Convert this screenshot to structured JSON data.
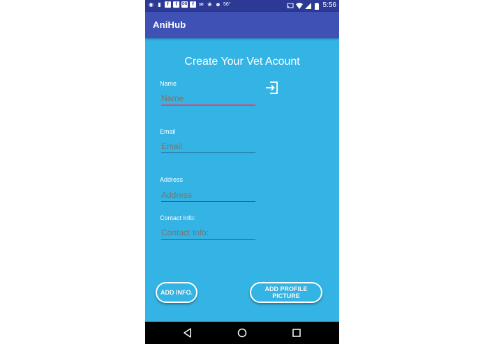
{
  "status_bar": {
    "time": "5:56",
    "temperature": "56°",
    "icons": [
      "camera-icon",
      "video-icon",
      "facebook-icon",
      "facebook-icon",
      "news-icon",
      "facebook-icon",
      "mail-icon",
      "pinwheel-icon",
      "character-icon",
      "cast-icon",
      "wifi-icon",
      "signal-icon",
      "battery-icon"
    ],
    "news_label": "ON"
  },
  "app_bar": {
    "title": "AniHub"
  },
  "form": {
    "title": "Create Your Vet Acount",
    "fields": [
      {
        "label": "Name",
        "placeholder": "Name"
      },
      {
        "label": "Email",
        "placeholder": "Email"
      },
      {
        "label": "Address",
        "placeholder": "Address"
      },
      {
        "label": "Contact Info:",
        "placeholder": "Contact Info:"
      }
    ]
  },
  "buttons": {
    "add_info": "ADD INFO.",
    "add_profile_picture": "ADD PROFILE PICTURE"
  },
  "navigation": {
    "items": [
      "back-icon",
      "home-icon",
      "recents-icon"
    ]
  },
  "colors": {
    "background": "#34b4e4",
    "app_bar": "#3f51b5",
    "status_bar": "#2c3a96",
    "focus_underline": "#e0457a"
  }
}
